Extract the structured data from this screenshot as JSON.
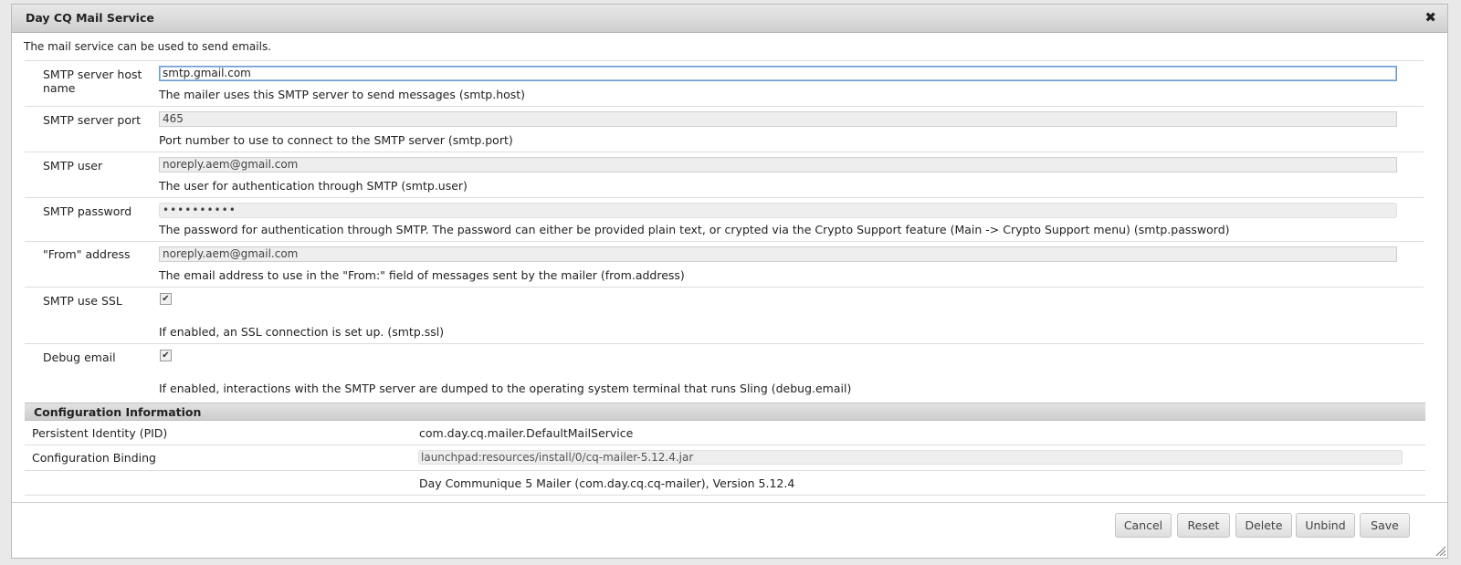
{
  "dialog": {
    "title": "Day CQ Mail Service",
    "close_icon": "✖",
    "description": "The mail service can be used to send emails."
  },
  "fields": {
    "host": {
      "label": "SMTP server host name",
      "value": "smtp.gmail.com",
      "help": "The mailer uses this SMTP server to send messages (smtp.host)"
    },
    "port": {
      "label": "SMTP server port",
      "value": "465",
      "help": "Port number to use to connect to the SMTP server (smtp.port)"
    },
    "user": {
      "label": "SMTP user",
      "value": "noreply.aem@gmail.com",
      "help": "The user for authentication through SMTP (smtp.user)"
    },
    "password": {
      "label": "SMTP password",
      "value": "••••••••••",
      "help": "The password for authentication through SMTP. The password can either be provided plain text, or crypted via the Crypto Support feature (Main -> Crypto Support menu) (smtp.password)"
    },
    "from": {
      "label": "\"From\" address",
      "value": "noreply.aem@gmail.com",
      "help": "The email address to use in the \"From:\" field of messages sent by the mailer (from.address)"
    },
    "ssl": {
      "label": "SMTP use SSL",
      "checked": true,
      "check_glyph": "✔",
      "help": "If enabled, an SSL connection is set up. (smtp.ssl)"
    },
    "debug": {
      "label": "Debug email",
      "checked": true,
      "check_glyph": "✔",
      "help": "If enabled, interactions with the SMTP server are dumped to the operating system terminal that runs Sling (debug.email)"
    }
  },
  "config_info": {
    "heading": "Configuration Information",
    "pid_label": "Persistent Identity (PID)",
    "pid_value": "com.day.cq.mailer.DefaultMailService",
    "binding_label": "Configuration Binding",
    "binding_value": "launchpad:resources/install/0/cq-mailer-5.12.4.jar",
    "bundle_value": "Day Communique 5 Mailer (com.day.cq.cq-mailer), Version 5.12.4"
  },
  "buttons": {
    "cancel": "Cancel",
    "reset": "Reset",
    "delete": "Delete",
    "unbind": "Unbind",
    "save": "Save"
  }
}
